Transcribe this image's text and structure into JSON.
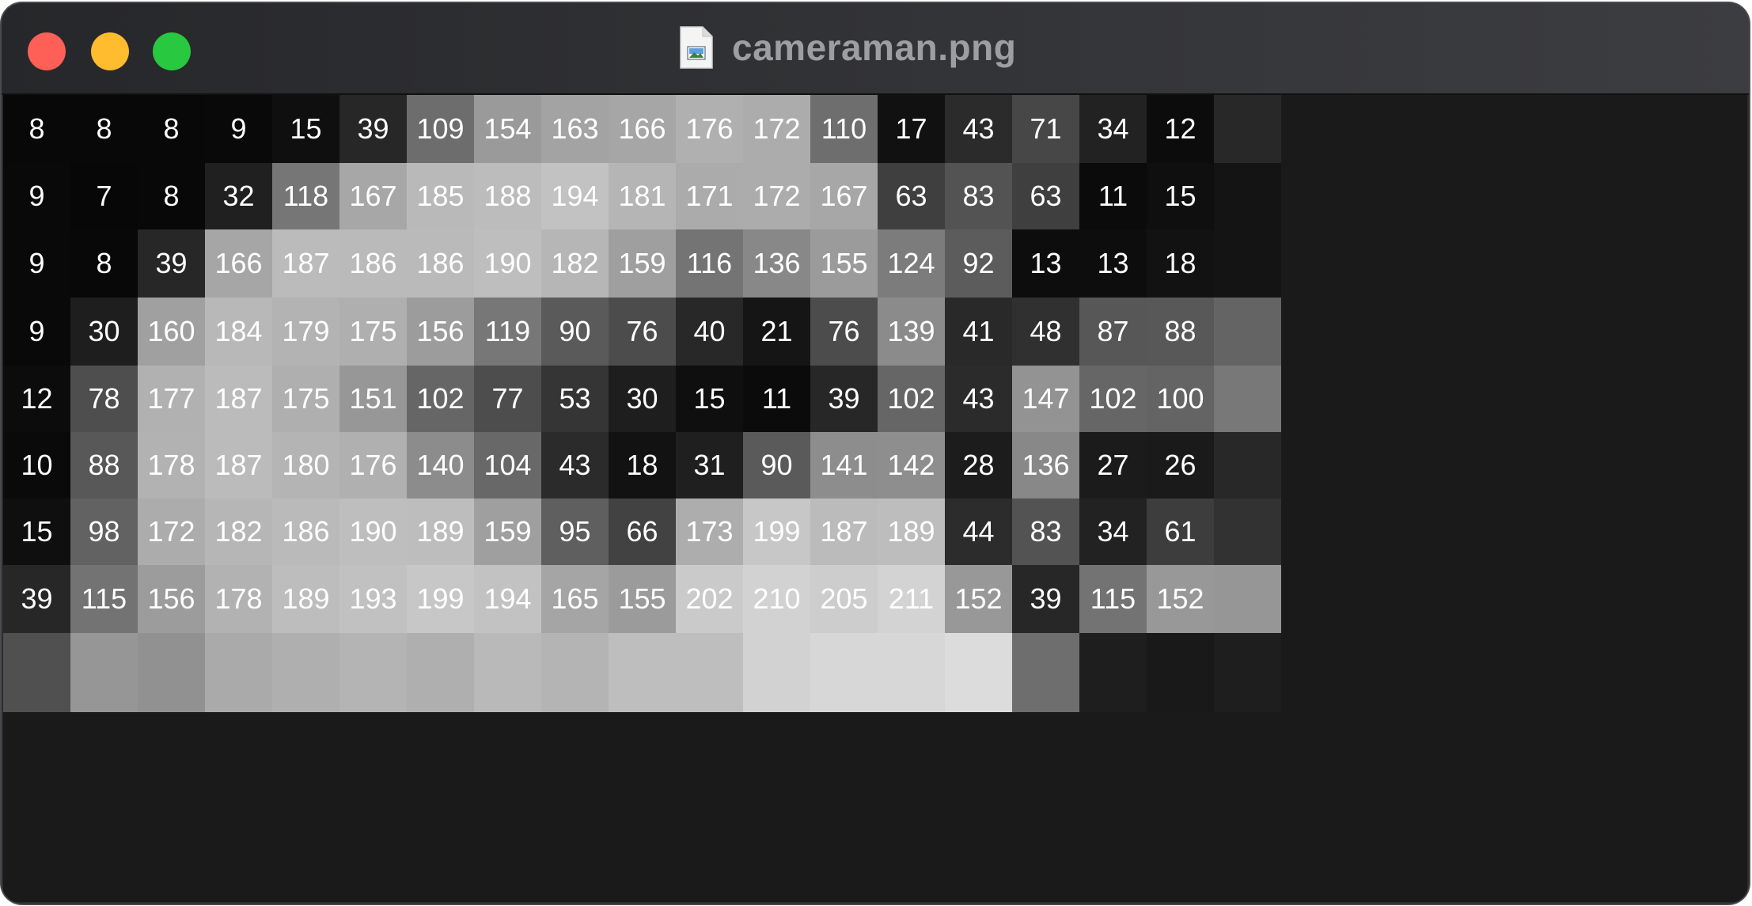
{
  "window": {
    "title": "cameraman.png",
    "file_icon": "image-file-icon",
    "traffic_lights": {
      "close": "#fe5f57",
      "minimize": "#febc2e",
      "zoom": "#28c840"
    }
  },
  "pixel_grid": {
    "rows": [
      [
        8,
        8,
        8,
        9,
        15,
        39,
        109,
        154,
        163,
        166,
        176,
        172,
        110,
        17,
        43,
        71,
        34,
        12
      ],
      [
        9,
        7,
        8,
        32,
        118,
        167,
        185,
        188,
        194,
        181,
        171,
        172,
        167,
        63,
        83,
        63,
        11,
        15
      ],
      [
        9,
        8,
        39,
        166,
        187,
        186,
        186,
        190,
        182,
        159,
        116,
        136,
        155,
        124,
        92,
        13,
        13,
        18
      ],
      [
        9,
        30,
        160,
        184,
        179,
        175,
        156,
        119,
        90,
        76,
        40,
        21,
        76,
        139,
        41,
        48,
        87,
        88
      ],
      [
        12,
        78,
        177,
        187,
        175,
        151,
        102,
        77,
        53,
        30,
        15,
        11,
        39,
        102,
        43,
        147,
        102,
        100
      ],
      [
        10,
        88,
        178,
        187,
        180,
        176,
        140,
        104,
        43,
        18,
        31,
        90,
        141,
        142,
        28,
        136,
        27,
        26
      ],
      [
        15,
        98,
        172,
        182,
        186,
        190,
        189,
        159,
        95,
        66,
        173,
        199,
        187,
        189,
        44,
        83,
        34,
        61
      ],
      [
        39,
        115,
        156,
        178,
        189,
        193,
        199,
        194,
        165,
        155,
        202,
        210,
        205,
        211,
        152,
        39,
        115,
        152
      ]
    ],
    "partial_right_column": [
      40,
      20,
      20,
      100,
      120,
      40,
      50,
      150
    ],
    "partial_bottom_row": [
      80,
      150,
      145,
      170,
      175,
      180,
      175,
      185,
      180,
      190,
      190,
      210,
      215,
      215,
      220,
      110,
      30,
      25,
      30
    ]
  }
}
